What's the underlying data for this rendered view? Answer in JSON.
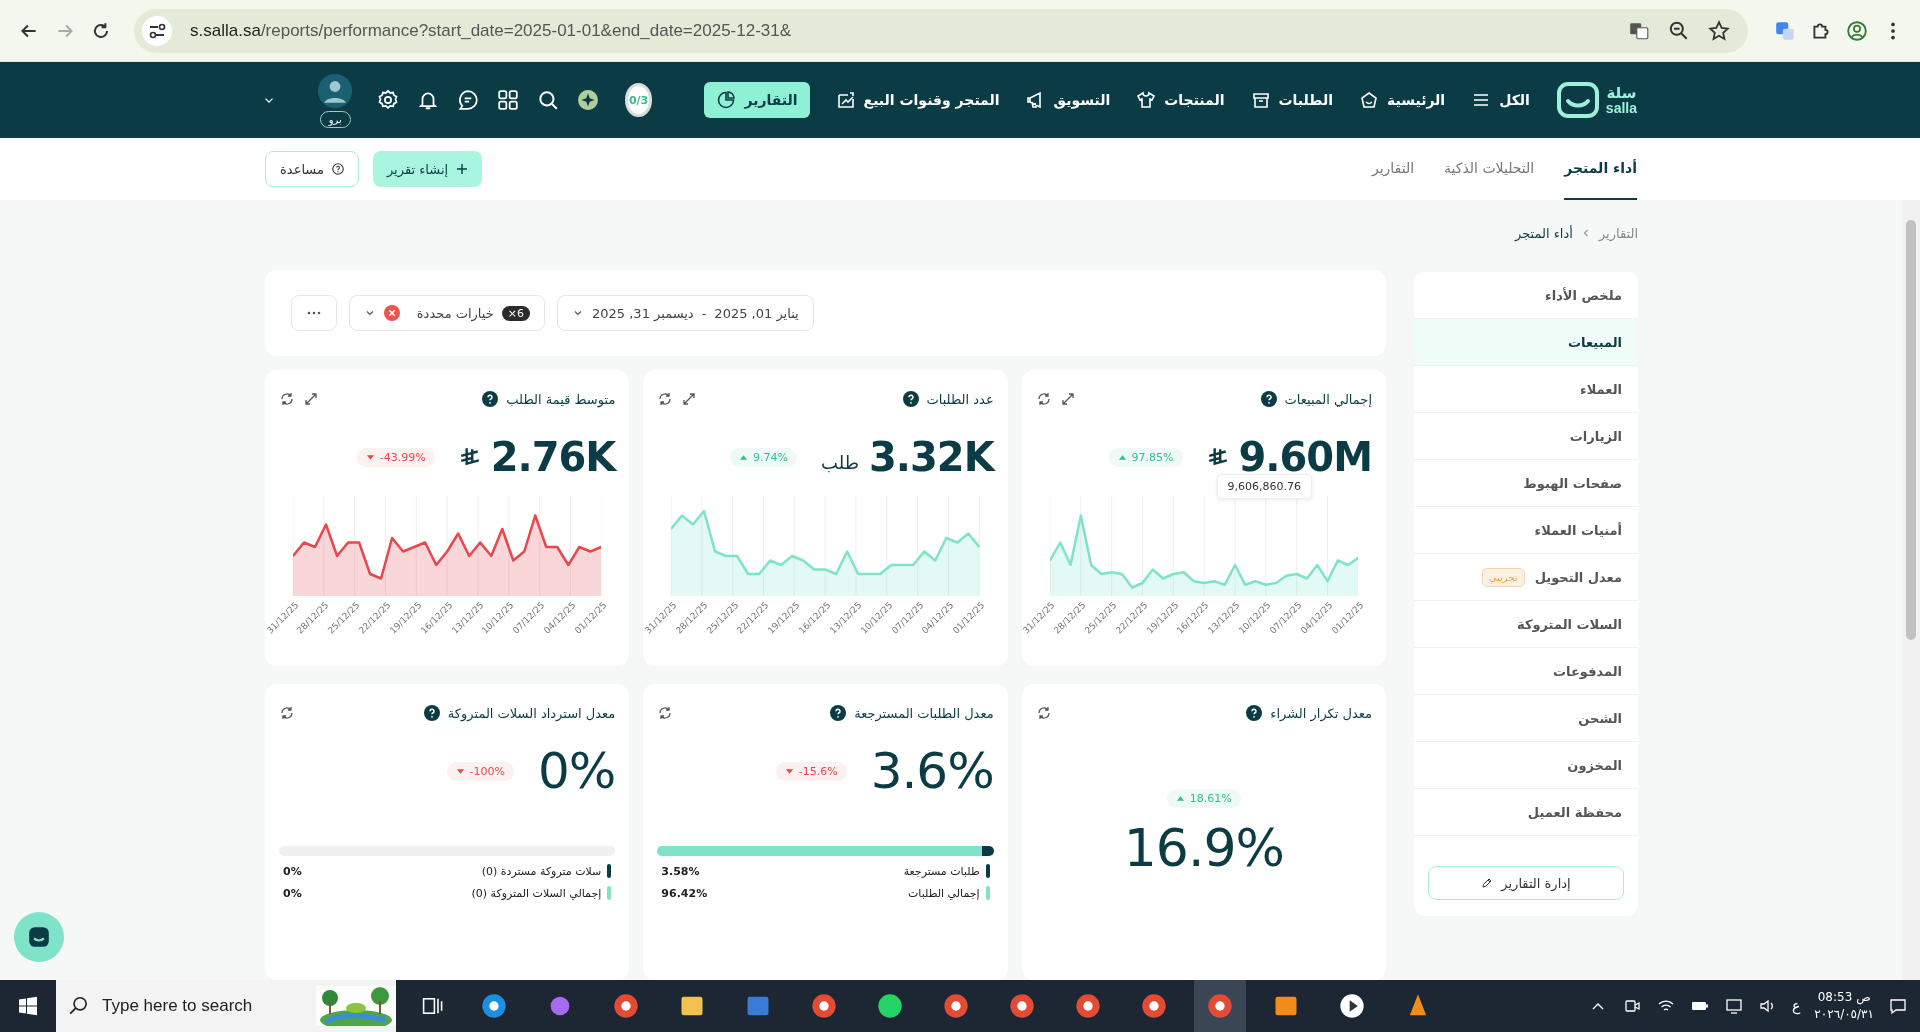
{
  "browser": {
    "url_host": "s.salla.sa",
    "url_path": "/reports/performance?start_date=2025-01-01&end_date=2025-12-31&"
  },
  "nav": {
    "logo_ar": "سلة",
    "logo_en": "salla",
    "items": [
      {
        "label": "الكل",
        "selected": false
      },
      {
        "label": "الرئيسية",
        "selected": false
      },
      {
        "label": "الطلبات",
        "selected": false
      },
      {
        "label": "المنتجات",
        "selected": false
      },
      {
        "label": "التسويق",
        "selected": false
      },
      {
        "label": "المتجر وقنوات البيع",
        "selected": false
      },
      {
        "label": "التقارير",
        "selected": true
      }
    ],
    "progress": "0/3",
    "plan_badge": "برو"
  },
  "tabs": [
    {
      "label": "أداء المتجر",
      "selected": true
    },
    {
      "label": "التحليلات الذكية",
      "selected": false
    },
    {
      "label": "التقارير",
      "selected": false
    }
  ],
  "actions": {
    "create": "إنشاء تقرير",
    "help": "مساعدة"
  },
  "breadcrumb": [
    "التقارير",
    "أداء المتجر"
  ],
  "sidebar": {
    "items": [
      {
        "label": "ملخص الأداء",
        "selected": false
      },
      {
        "label": "المبيعات",
        "selected": true
      },
      {
        "label": "العملاء",
        "selected": false
      },
      {
        "label": "الزيارات",
        "selected": false
      },
      {
        "label": "صفحات الهبوط",
        "selected": false
      },
      {
        "label": "أمنيات العملاء",
        "selected": false
      },
      {
        "label": "معدل التحويل",
        "selected": false,
        "badge": "تجريبي"
      },
      {
        "label": "السلات المتروكة",
        "selected": false
      },
      {
        "label": "المدفوعات",
        "selected": false
      },
      {
        "label": "الشحن",
        "selected": false
      },
      {
        "label": "المخزون",
        "selected": false
      },
      {
        "label": "محفظة العميل",
        "selected": false
      }
    ],
    "manage_button": "إدارة التقارير"
  },
  "filters": {
    "date_start": "يناير 01, 2025",
    "date_separator": "-",
    "date_end": "ديسمبر 31, 2025",
    "options_count": "×6",
    "options_label": "خيارات محددة"
  },
  "cards": [
    {
      "kind": "chart",
      "title": "إجمالي المبيعات",
      "value": "9.60M",
      "currency": true,
      "change": "97.85%",
      "increase": true,
      "tooltip": "9,606,860.76",
      "x_labels": [
        "31/12/25",
        "28/12/25",
        "25/12/25",
        "22/12/25",
        "19/12/25",
        "16/12/25",
        "13/12/25",
        "10/12/25",
        "07/12/25",
        "04/12/25",
        "01/12/25"
      ]
    },
    {
      "kind": "chart",
      "title": "عدد الطلبات",
      "value": "3.32K",
      "unit": "طلب",
      "currency": false,
      "change": "9.74%",
      "increase": true,
      "x_labels": [
        "31/12/25",
        "28/12/25",
        "25/12/25",
        "22/12/25",
        "19/12/25",
        "16/12/25",
        "13/12/25",
        "10/12/25",
        "07/12/25",
        "04/12/25",
        "01/12/25"
      ]
    },
    {
      "kind": "chart",
      "title": "متوسط قيمة الطلب",
      "value": "2.76K",
      "currency": true,
      "change": "-43.99%",
      "increase": false,
      "x_labels": [
        "31/12/25",
        "28/12/25",
        "25/12/25",
        "22/12/25",
        "19/12/25",
        "16/12/25",
        "13/12/25",
        "10/12/25",
        "07/12/25",
        "04/12/25",
        "01/12/25"
      ]
    },
    {
      "kind": "center",
      "title": "معدل تكرار الشراء",
      "value": "16.9%",
      "change": "18.61%",
      "increase": true
    },
    {
      "kind": "split",
      "title": "معدل الطلبات المسترجعة",
      "value": "3.6%",
      "change": "-15.6%",
      "increase": false,
      "segments": [
        {
          "label": "طلبات مسترجعة",
          "share": "3.58%",
          "level": 0.0358,
          "kind": "part"
        },
        {
          "label": "إجمالي الطلبات",
          "share": "96.42%",
          "level": 0.9642,
          "kind": "total"
        }
      ]
    },
    {
      "kind": "split",
      "title": "معدل استرداد السلات المتروكة",
      "value": "0%",
      "change": "-100%",
      "increase": false,
      "segments": [
        {
          "label": "سلات متروكة مستردة (0)",
          "share": "0%",
          "level": 0,
          "kind": "part"
        },
        {
          "label": "إجمالي السلات المتروكة (0)",
          "share": "0%",
          "level": 0,
          "kind": "total"
        }
      ]
    }
  ],
  "taskbar": {
    "search_placeholder": "Type here to search",
    "language": "ع",
    "time": "08:53",
    "period": "ص",
    "date": "٢٠٢٦/٠٥/٣١"
  }
}
